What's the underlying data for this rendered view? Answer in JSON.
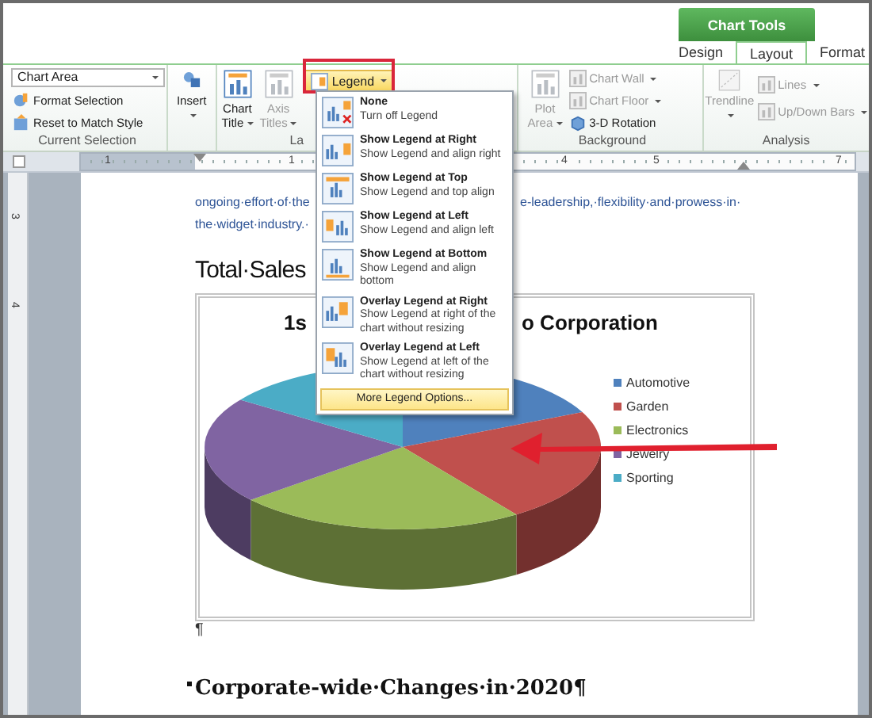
{
  "ribbon": {
    "contextual_tab": "Chart Tools",
    "tabs": [
      {
        "label": "Design",
        "selected": false
      },
      {
        "label": "Layout",
        "selected": true
      },
      {
        "label": "Format",
        "selected": false
      }
    ],
    "current_selection": {
      "dropdown": "Chart Area",
      "buttons": [
        "Format Selection",
        "Reset to Match Style"
      ],
      "label": "Current Selection"
    },
    "insert": {
      "lines": [
        "Insert"
      ],
      "disabled": false
    },
    "labels_group": {
      "buttons": [
        {
          "lines": [
            "Chart",
            "Title"
          ],
          "disabled": false
        },
        {
          "lines": [
            "Axis",
            "Titles"
          ],
          "disabled": true
        }
      ],
      "legend_button": "Legend",
      "label": "La"
    },
    "background": {
      "big": {
        "lines": [
          "Plot",
          "Area"
        ],
        "disabled": true
      },
      "small_buttons": [
        {
          "label": "Chart Wall",
          "disabled": true,
          "has_menu": true
        },
        {
          "label": "Chart Floor",
          "disabled": true,
          "has_menu": true
        },
        {
          "label": "3-D Rotation",
          "disabled": false,
          "has_menu": false
        }
      ],
      "label": "Background"
    },
    "analysis": {
      "big": {
        "lines": [
          "Trendline"
        ],
        "disabled": true
      },
      "small_buttons": [
        {
          "label": "Lines",
          "disabled": true,
          "has_menu": true
        },
        {
          "label": "Up/Down Bars",
          "disabled": true,
          "has_menu": true
        }
      ],
      "label": "Analysis"
    }
  },
  "ruler": {
    "top_numbers": [
      "1",
      "1",
      "4",
      "5",
      "7"
    ],
    "side_numbers": [
      "3",
      "4"
    ]
  },
  "document": {
    "line_1_left": "ongoing·effort·of·the",
    "line_1_right": "e-leadership,·flexibility·and·prowess·in·",
    "line_2": "the·widget·industry.·",
    "heading": "Total·Sales",
    "chart": {
      "title_parts": [
        "1s",
        "o Corporation"
      ],
      "legend": [
        {
          "label": "Automotive",
          "color": "#4f81bd"
        },
        {
          "label": "Garden",
          "color": "#c0504d"
        },
        {
          "label": "Electronics",
          "color": "#9bbb59"
        },
        {
          "label": "Jewelry",
          "color": "#8064a2"
        },
        {
          "label": "Sporting",
          "color": "#4bacc6"
        }
      ]
    },
    "pilcrow": "¶",
    "heading_2": "Corporate-wide·Changes·in·2020¶"
  },
  "legend_menu": {
    "items": [
      {
        "kind": "none",
        "title": "None",
        "description": "Turn off Legend"
      },
      {
        "kind": "right",
        "title": "Show Legend at Right",
        "description": "Show Legend and align right"
      },
      {
        "kind": "top",
        "title": "Show Legend at Top",
        "description": "Show Legend and top align"
      },
      {
        "kind": "left",
        "title": "Show Legend at Left",
        "description": "Show Legend and align left"
      },
      {
        "kind": "bottom",
        "title": "Show Legend at Bottom",
        "description": "Show Legend and align bottom"
      },
      {
        "kind": "overlay_right",
        "title": "Overlay Legend at Right",
        "description": "Show Legend at right of the chart without resizing"
      },
      {
        "kind": "overlay_left",
        "title": "Overlay Legend at Left",
        "description": "Show Legend at left of the chart without resizing"
      }
    ],
    "footer": {
      "label": "More Legend Options...",
      "highlighted": true
    }
  }
}
